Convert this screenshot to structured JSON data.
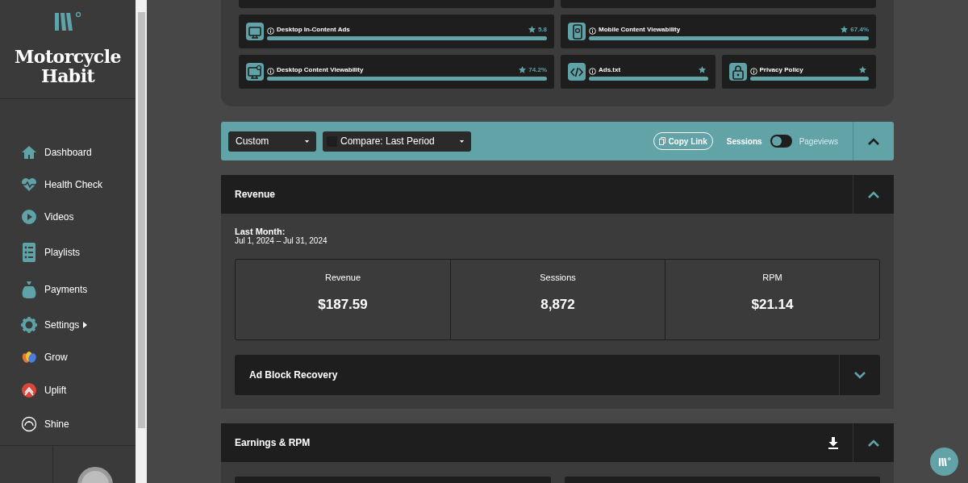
{
  "brand": {
    "title": "Motorcycle Habit"
  },
  "nav": [
    {
      "label": "Dashboard",
      "submenu": false
    },
    {
      "label": "Health Check",
      "submenu": false
    },
    {
      "label": "Videos",
      "submenu": false
    },
    {
      "label": "Playlists",
      "submenu": false
    },
    {
      "label": "Payments",
      "submenu": false
    },
    {
      "label": "Settings",
      "submenu": true
    },
    {
      "label": "Grow",
      "submenu": false
    },
    {
      "label": "Uplift",
      "submenu": false
    },
    {
      "label": "Shine",
      "submenu": false
    }
  ],
  "health_rows": [
    [
      {
        "title": "Desktop In-Content Ads",
        "score": "5.8",
        "level": 1
      },
      {
        "title": "Mobile Content Viewability",
        "score": "67.4%",
        "level": 1
      }
    ],
    [
      {
        "title": "Desktop Content Viewability",
        "score": "74.2%",
        "level": 1
      },
      {
        "title": "Ads.txt",
        "level": 1
      },
      {
        "title": "Privacy Policy",
        "level": 1
      }
    ]
  ],
  "filters": {
    "range": "Custom",
    "compare": "Compare: Last Period",
    "copy_link": "Copy Link",
    "toggle_left": "Sessions",
    "toggle_right": "Pageviews",
    "toggle_on": false,
    "expanded": true
  },
  "revenue": {
    "title": "Revenue",
    "expanded": true,
    "period_label": "Last Month:",
    "period_dates": "Jul 1, 2024 – Jul 31, 2024",
    "stats": [
      {
        "label": "Revenue",
        "value": "$187.59"
      },
      {
        "label": "Sessions",
        "value": "8,872"
      },
      {
        "label": "RPM",
        "value": "$21.14"
      }
    ]
  },
  "ad_block": {
    "title": "Ad Block Recovery",
    "expanded": false
  },
  "earnings": {
    "title": "Earnings & RPM",
    "expanded": true
  }
}
